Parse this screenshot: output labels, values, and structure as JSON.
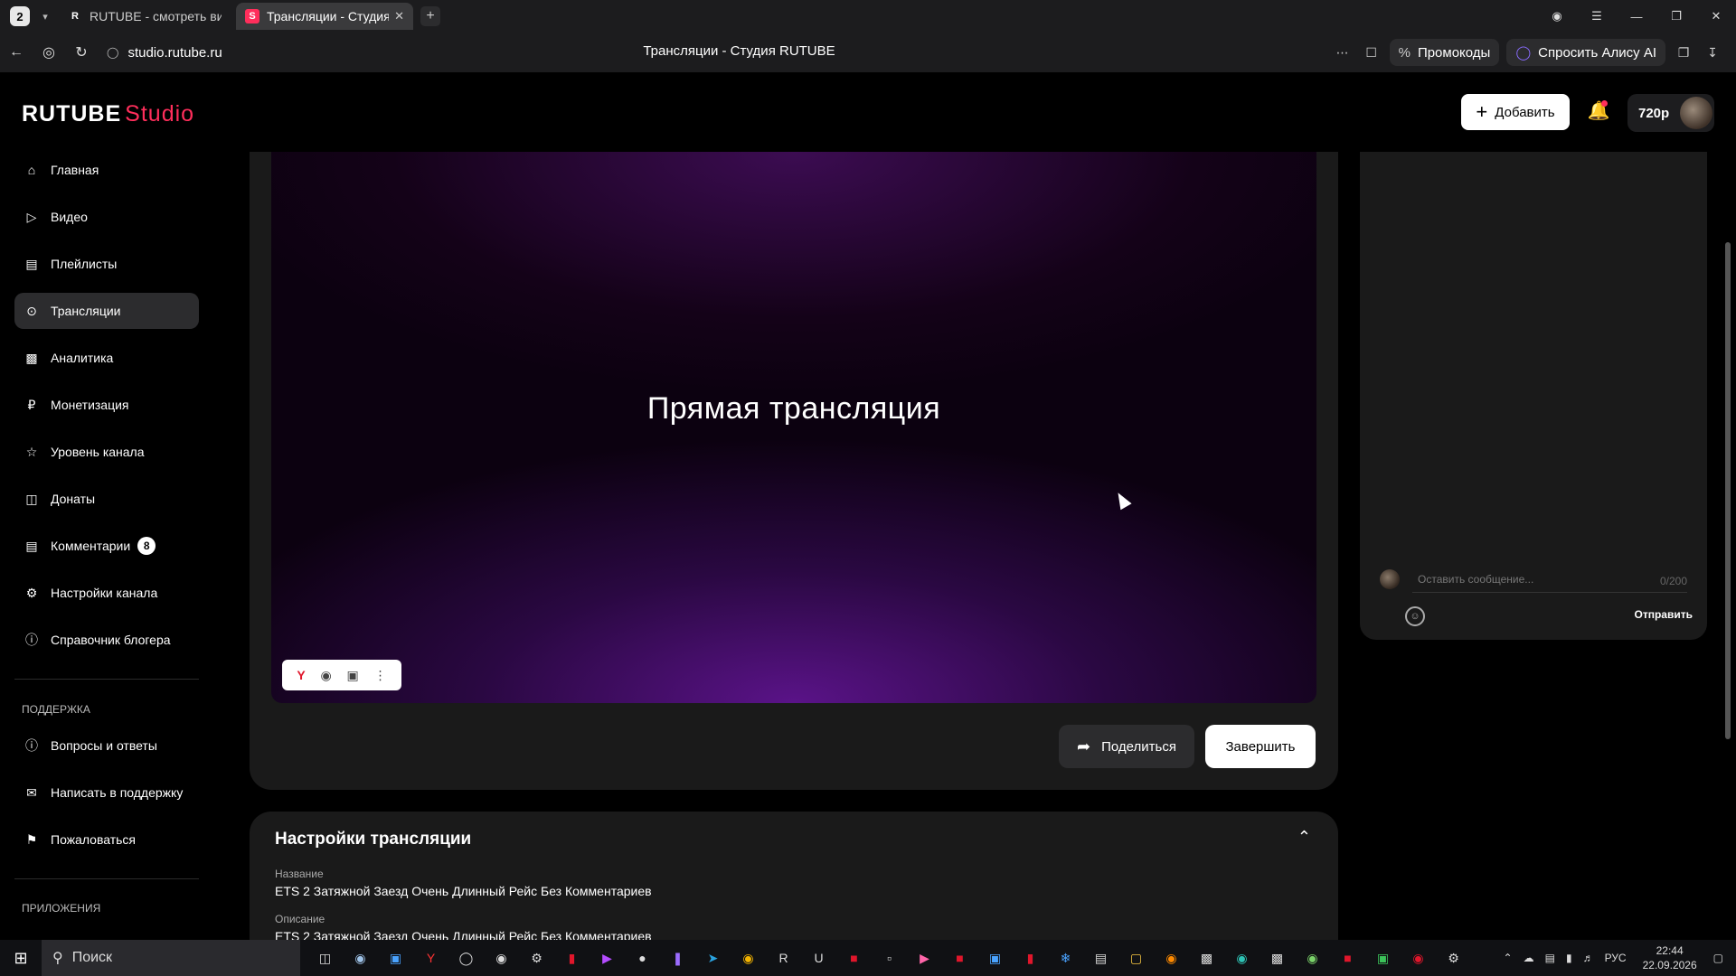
{
  "browser": {
    "tab_count": "2",
    "tabs": [
      {
        "title": "RUTUBE - смотреть видео",
        "favicon": "R"
      },
      {
        "title": "Трансляции - Студия RUTUBE",
        "favicon": "S"
      }
    ],
    "url": "studio.rutube.ru",
    "page_title": "Трансляции - Студия RUTUBE",
    "promo_label": "Промокоды",
    "alice_label": "Спросить Алису AI"
  },
  "header": {
    "logo_main": "RUTUBE",
    "logo_sub": "Studio",
    "add_label": "Добавить",
    "quality": "720p"
  },
  "sidebar": {
    "items": [
      {
        "label": "Главная",
        "icon": "home-icon"
      },
      {
        "label": "Видео",
        "icon": "video-icon"
      },
      {
        "label": "Плейлисты",
        "icon": "playlist-icon"
      },
      {
        "label": "Трансляции",
        "icon": "broadcast-icon"
      },
      {
        "label": "Аналитика",
        "icon": "analytics-icon"
      },
      {
        "label": "Монетизация",
        "icon": "ruble-icon"
      },
      {
        "label": "Уровень канала",
        "icon": "star-icon"
      },
      {
        "label": "Донаты",
        "icon": "donate-icon"
      },
      {
        "label": "Комментарии",
        "icon": "comment-icon",
        "badge": "8"
      },
      {
        "label": "Настройки канала",
        "icon": "gear-icon"
      },
      {
        "label": "Справочник блогера",
        "icon": "info-icon"
      }
    ],
    "support_heading": "ПОДДЕРЖКА",
    "support_items": [
      {
        "label": "Вопросы и ответы",
        "icon": "question-icon"
      },
      {
        "label": "Написать в поддержку",
        "icon": "mail-icon"
      },
      {
        "label": "Пожаловаться",
        "icon": "flag-icon"
      }
    ],
    "apps_heading": "ПРИЛОЖЕНИЯ"
  },
  "player": {
    "title": "Прямая трансляция"
  },
  "actions": {
    "share_label": "Поделиться",
    "finish_label": "Завершить"
  },
  "chat": {
    "placeholder": "Оставить сообщение...",
    "counter": "0/200",
    "send_label": "Отправить"
  },
  "settings": {
    "title": "Настройки трансляции",
    "name_label": "Название",
    "name_value": "ETS 2 Затяжной Заезд Очень Длинный Рейс Без Комментариев",
    "desc_label": "Описание",
    "desc_value": "ETS 2 Затяжной Заезд Очень Длинный Рейс Без Комментариев"
  },
  "taskbar": {
    "search_label": "Поиск",
    "language": "РУС",
    "time": "22:44",
    "date": "22.09.2026"
  },
  "colors": {
    "accent": "#ff2e5b",
    "background": "#000000",
    "card": "#1a1a1a"
  }
}
